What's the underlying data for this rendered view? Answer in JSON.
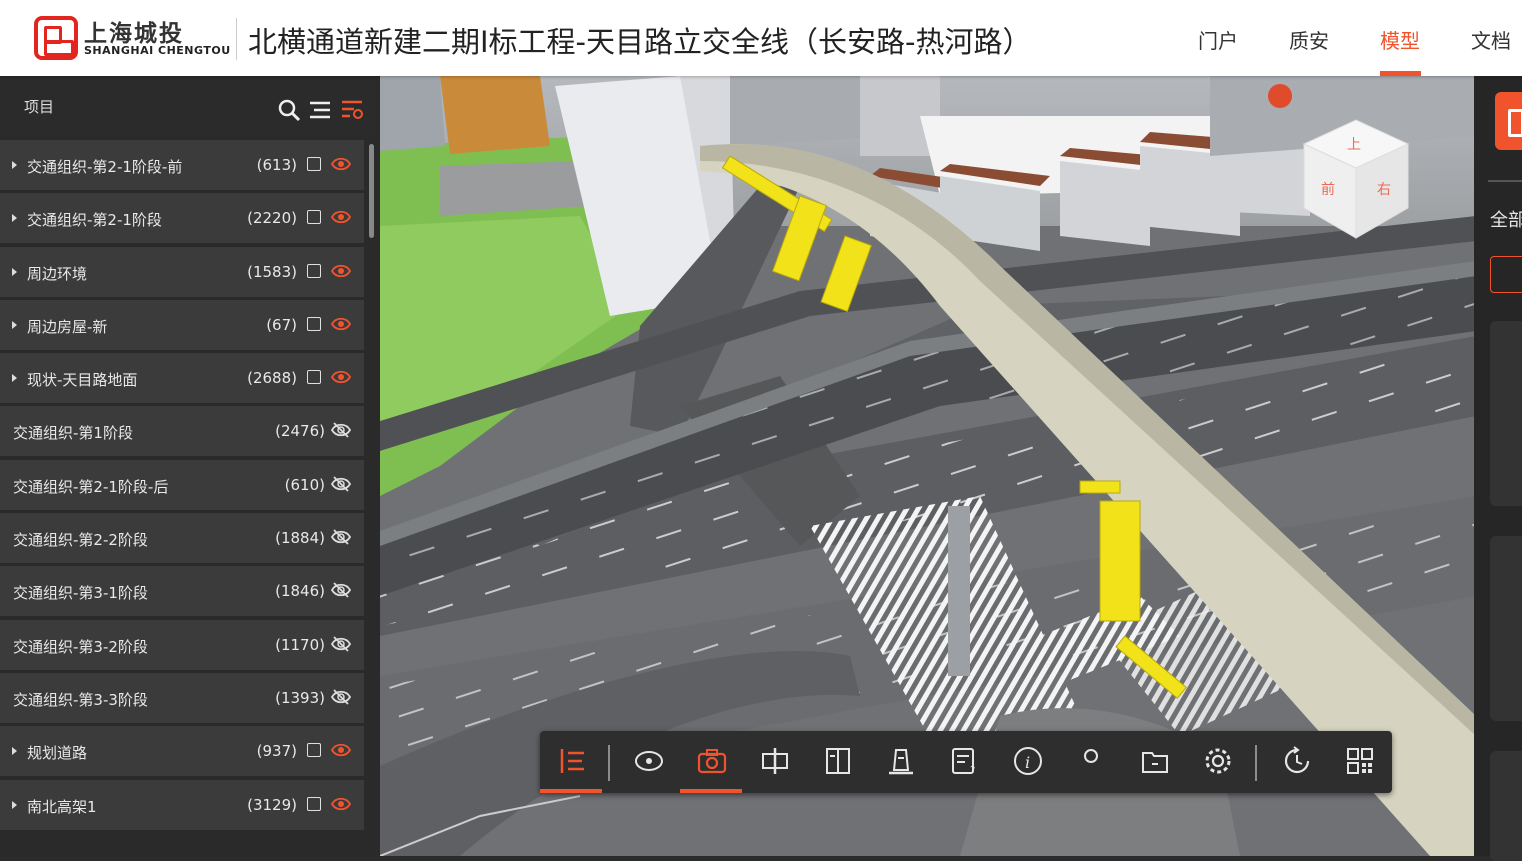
{
  "header": {
    "logo_cn": "上海城投",
    "logo_en": "SHANGHAI CHENGTOU",
    "title": "北横通道新建二期I标工程-天目路立交全线（长安路-热河路）",
    "nav": [
      {
        "label": "门户",
        "active": false
      },
      {
        "label": "质安",
        "active": false
      },
      {
        "label": "模型",
        "active": true
      },
      {
        "label": "文档",
        "active": false
      }
    ]
  },
  "sidebar": {
    "title": "项目",
    "tools": [
      "search-icon",
      "list-icon",
      "filter-list-icon"
    ],
    "items": [
      {
        "label": "交通组织-第2-1阶段-前",
        "count": "(613)",
        "expandable": true,
        "visible": true
      },
      {
        "label": "交通组织-第2-1阶段",
        "count": "(2220)",
        "expandable": true,
        "visible": true
      },
      {
        "label": "周边环境",
        "count": "(1583)",
        "expandable": true,
        "visible": true
      },
      {
        "label": "周边房屋-新",
        "count": "(67)",
        "expandable": true,
        "visible": true
      },
      {
        "label": "现状-天目路地面",
        "count": "(2688)",
        "expandable": true,
        "visible": true
      },
      {
        "label": "交通组织-第1阶段",
        "count": "(2476)",
        "expandable": false,
        "visible": false
      },
      {
        "label": "交通组织-第2-1阶段-后",
        "count": "(610)",
        "expandable": false,
        "visible": false
      },
      {
        "label": "交通组织-第2-2阶段",
        "count": "(1884)",
        "expandable": false,
        "visible": false
      },
      {
        "label": "交通组织-第3-1阶段",
        "count": "(1846)",
        "expandable": false,
        "visible": false
      },
      {
        "label": "交通组织-第3-2阶段",
        "count": "(1170)",
        "expandable": false,
        "visible": false
      },
      {
        "label": "交通组织-第3-3阶段",
        "count": "(1393)",
        "expandable": false,
        "visible": false
      },
      {
        "label": "规划道路",
        "count": "(937)",
        "expandable": true,
        "visible": true
      },
      {
        "label": "南北高架1",
        "count": "(3129)",
        "expandable": true,
        "visible": true
      }
    ]
  },
  "view_cube": {
    "top_label": "上",
    "front_label": "前",
    "right_label": "右"
  },
  "toolbar": {
    "buttons": [
      {
        "name": "tree-icon",
        "active": true
      },
      {
        "name": "orbit-icon",
        "active": false
      },
      {
        "name": "camera-icon",
        "active": true
      },
      {
        "name": "section-icon",
        "active": false
      },
      {
        "name": "split-icon",
        "active": false
      },
      {
        "name": "measure-icon",
        "active": false
      },
      {
        "name": "annotation-icon",
        "active": false
      },
      {
        "name": "info-icon",
        "active": false
      },
      {
        "name": "location-icon",
        "active": false
      },
      {
        "name": "folder-icon",
        "active": false
      },
      {
        "name": "settings-icon",
        "active": false
      },
      {
        "name": "history-icon",
        "active": false
      },
      {
        "name": "grid-icon",
        "active": false
      }
    ]
  },
  "right_panel": {
    "label": "全部"
  },
  "colors": {
    "accent": "#f1542c",
    "sidebar_bg": "#2a2a2a",
    "row_bg": "#3b3b3b"
  }
}
